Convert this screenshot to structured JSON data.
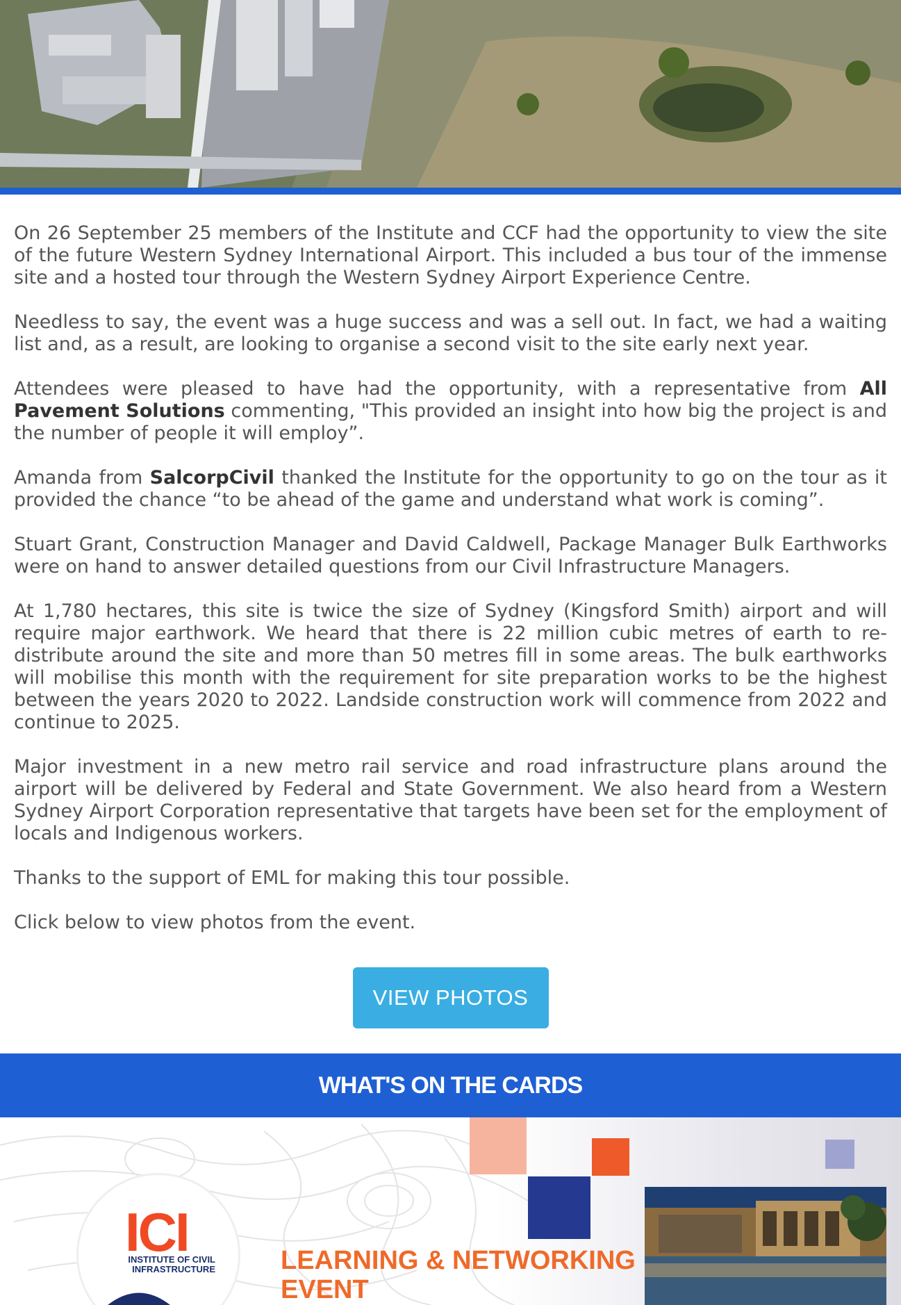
{
  "article": {
    "paragraphs": [
      "On 26 September 25 members of the Institute and CCF had the opportunity to view the site of the future Western Sydney International Airport.  This included a bus tour of the immense site and a hosted tour through the Western Sydney Airport Experience Centre.",
      "Needless to say, the event was a huge success and was a sell out. In fact, we had a waiting list and, as a result, are looking to organise a second visit to the site early next year.",
      null,
      null,
      "Stuart Grant, Construction Manager and David Caldwell, Package Manager Bulk Earthworks were on hand to answer detailed questions from our Civil Infrastructure Managers.",
      "At 1,780 hectares, this site is twice the size of Sydney (Kingsford Smith) airport and will require major earthwork.  We heard that there is 22 million cubic metres of earth to re-distribute around the site and more than 50 metres fill in some areas. The bulk earthworks will mobilise this month with the requirement for site preparation works to be the highest between the years 2020 to 2022.  Landside construction work will commence from 2022 and continue to 2025.",
      "Major investment in a new metro rail service and road infrastructure plans around the airport will be delivered by Federal and State Government.  We also heard from a Western Sydney Airport Corporation representative that targets have been set for the employment of locals and Indigenous workers.",
      "Thanks to the support of EML for making this tour possible.",
      "Click below to view photos from the event."
    ],
    "p3": {
      "before": "Attendees were pleased to have had the opportunity, with a representative from ",
      "company": "All Pavement Solutions",
      "after": " commenting, \"This provided an insight into how big the project is and the number of people it will employ”."
    },
    "p4": {
      "before": "Amanda from ",
      "company": "SalcorpCivil",
      "after": " thanked the Institute for the opportunity to go on the tour as it provided the chance “to be ahead of the game and understand what work is coming”."
    }
  },
  "button": {
    "label": "VIEW PHOTOS"
  },
  "section": {
    "title": "WHAT'S ON THE CARDS"
  },
  "event_banner": {
    "logo_text": "ICI",
    "logo_sub": "INSTITUTE OF CIVIL INFRASTRUCTURE",
    "title": "LEARNING & NETWORKING EVENT"
  },
  "colors": {
    "accent_blue": "#1e5fd4",
    "button_blue": "#3aaee2",
    "orange": "#ef4a24",
    "navy": "#1b2e6b"
  }
}
